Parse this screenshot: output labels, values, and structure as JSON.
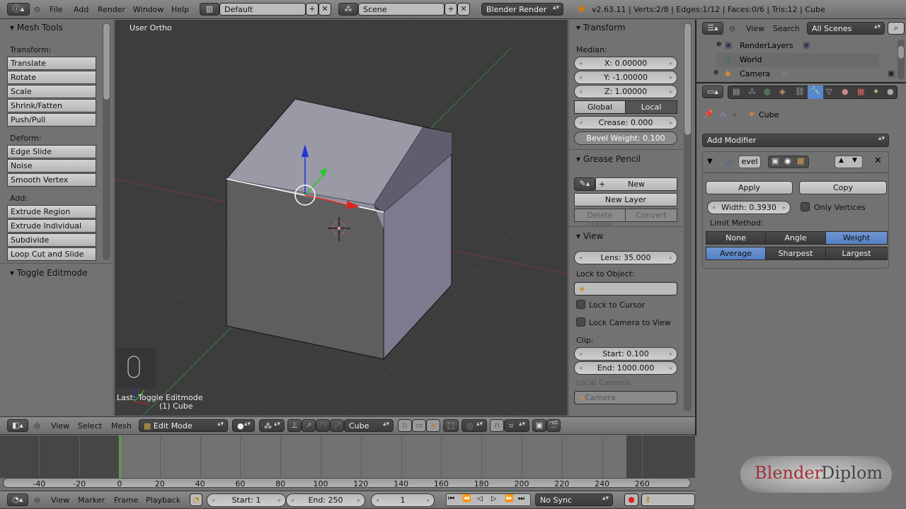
{
  "top_header": {
    "menus": [
      "File",
      "Add",
      "Render",
      "Window",
      "Help"
    ],
    "screen_layout": "Default",
    "scene": "Scene",
    "render_engine": "Blender Render",
    "stats": "v2.63.11 | Verts:2/8 | Edges:1/12 | Faces:0/6 | Tris:12 | Cube"
  },
  "tool_shelf": {
    "title": "Mesh Tools",
    "sections": [
      {
        "label": "Transform:",
        "buttons": [
          "Translate",
          "Rotate",
          "Scale",
          "Shrink/Fatten",
          "Push/Pull"
        ]
      },
      {
        "label": "Deform:",
        "buttons": [
          "Edge Slide",
          "Noise",
          "Smooth Vertex"
        ]
      },
      {
        "label": "Add:",
        "buttons": [
          "Extrude Region",
          "Extrude Individual",
          "Subdivide",
          "Loop Cut and Slide"
        ]
      }
    ],
    "operator_panel": "Toggle Editmode"
  },
  "viewport": {
    "view_label": "User Ortho",
    "last_operator": "Last: Toggle Editmode",
    "object_label": "(1) Cube"
  },
  "properties_panel": {
    "transform": {
      "title": "Transform",
      "median_label": "Median:",
      "x": "X: 0.00000",
      "y": "Y: -1.00000",
      "z": "Z: 1.00000",
      "global": "Global",
      "local": "Local",
      "crease": "Crease: 0.000",
      "bevel_weight": "Bevel Weight: 0.100"
    },
    "grease_pencil": {
      "title": "Grease Pencil",
      "new": "New",
      "new_layer": "New Layer",
      "delete_frame": "Delete Frame",
      "convert": "Convert"
    },
    "view": {
      "title": "View",
      "lens": "Lens: 35.000",
      "lock_to_object": "Lock to Object:",
      "lock_to_cursor": "Lock to Cursor",
      "lock_camera": "Lock Camera to View",
      "clip": "Clip:",
      "clip_start": "Start: 0.100",
      "clip_end": "End: 1000.000",
      "local_camera": "Local Camera:",
      "camera": "Camera"
    }
  },
  "outliner": {
    "menus": [
      "View",
      "Search"
    ],
    "filter": "All Scenes",
    "items": [
      "RenderLayers",
      "World",
      "Camera"
    ]
  },
  "properties_editor": {
    "breadcrumb": "Cube",
    "add_modifier": "Add Modifier",
    "modifier": {
      "name": "evel",
      "apply": "Apply",
      "copy": "Copy",
      "width": "Width: 0.3930",
      "only_vertices": "Only Vertices",
      "limit_method_label": "Limit Method:",
      "limit_methods": [
        "None",
        "Angle",
        "Weight"
      ],
      "limit_selected": "Weight",
      "weight_modes": [
        "Average",
        "Sharpest",
        "Largest"
      ],
      "weight_selected": "Average"
    }
  },
  "viewport_header": {
    "menus": [
      "View",
      "Select",
      "Mesh"
    ],
    "mode": "Edit Mode",
    "orientation_object": "Cube"
  },
  "timeline": {
    "ticks": [
      "-40",
      "-20",
      "0",
      "20",
      "40",
      "60",
      "80",
      "100",
      "120",
      "140",
      "160",
      "180",
      "200",
      "220",
      "240",
      "260"
    ],
    "current_frame_marker": 0,
    "menus": [
      "View",
      "Marker",
      "Frame",
      "Playback"
    ],
    "start": "Start: 1",
    "end": "End: 250",
    "current": "1",
    "sync": "No Sync"
  },
  "watermark": {
    "part1": "Blender",
    "part2": "Diplom"
  }
}
